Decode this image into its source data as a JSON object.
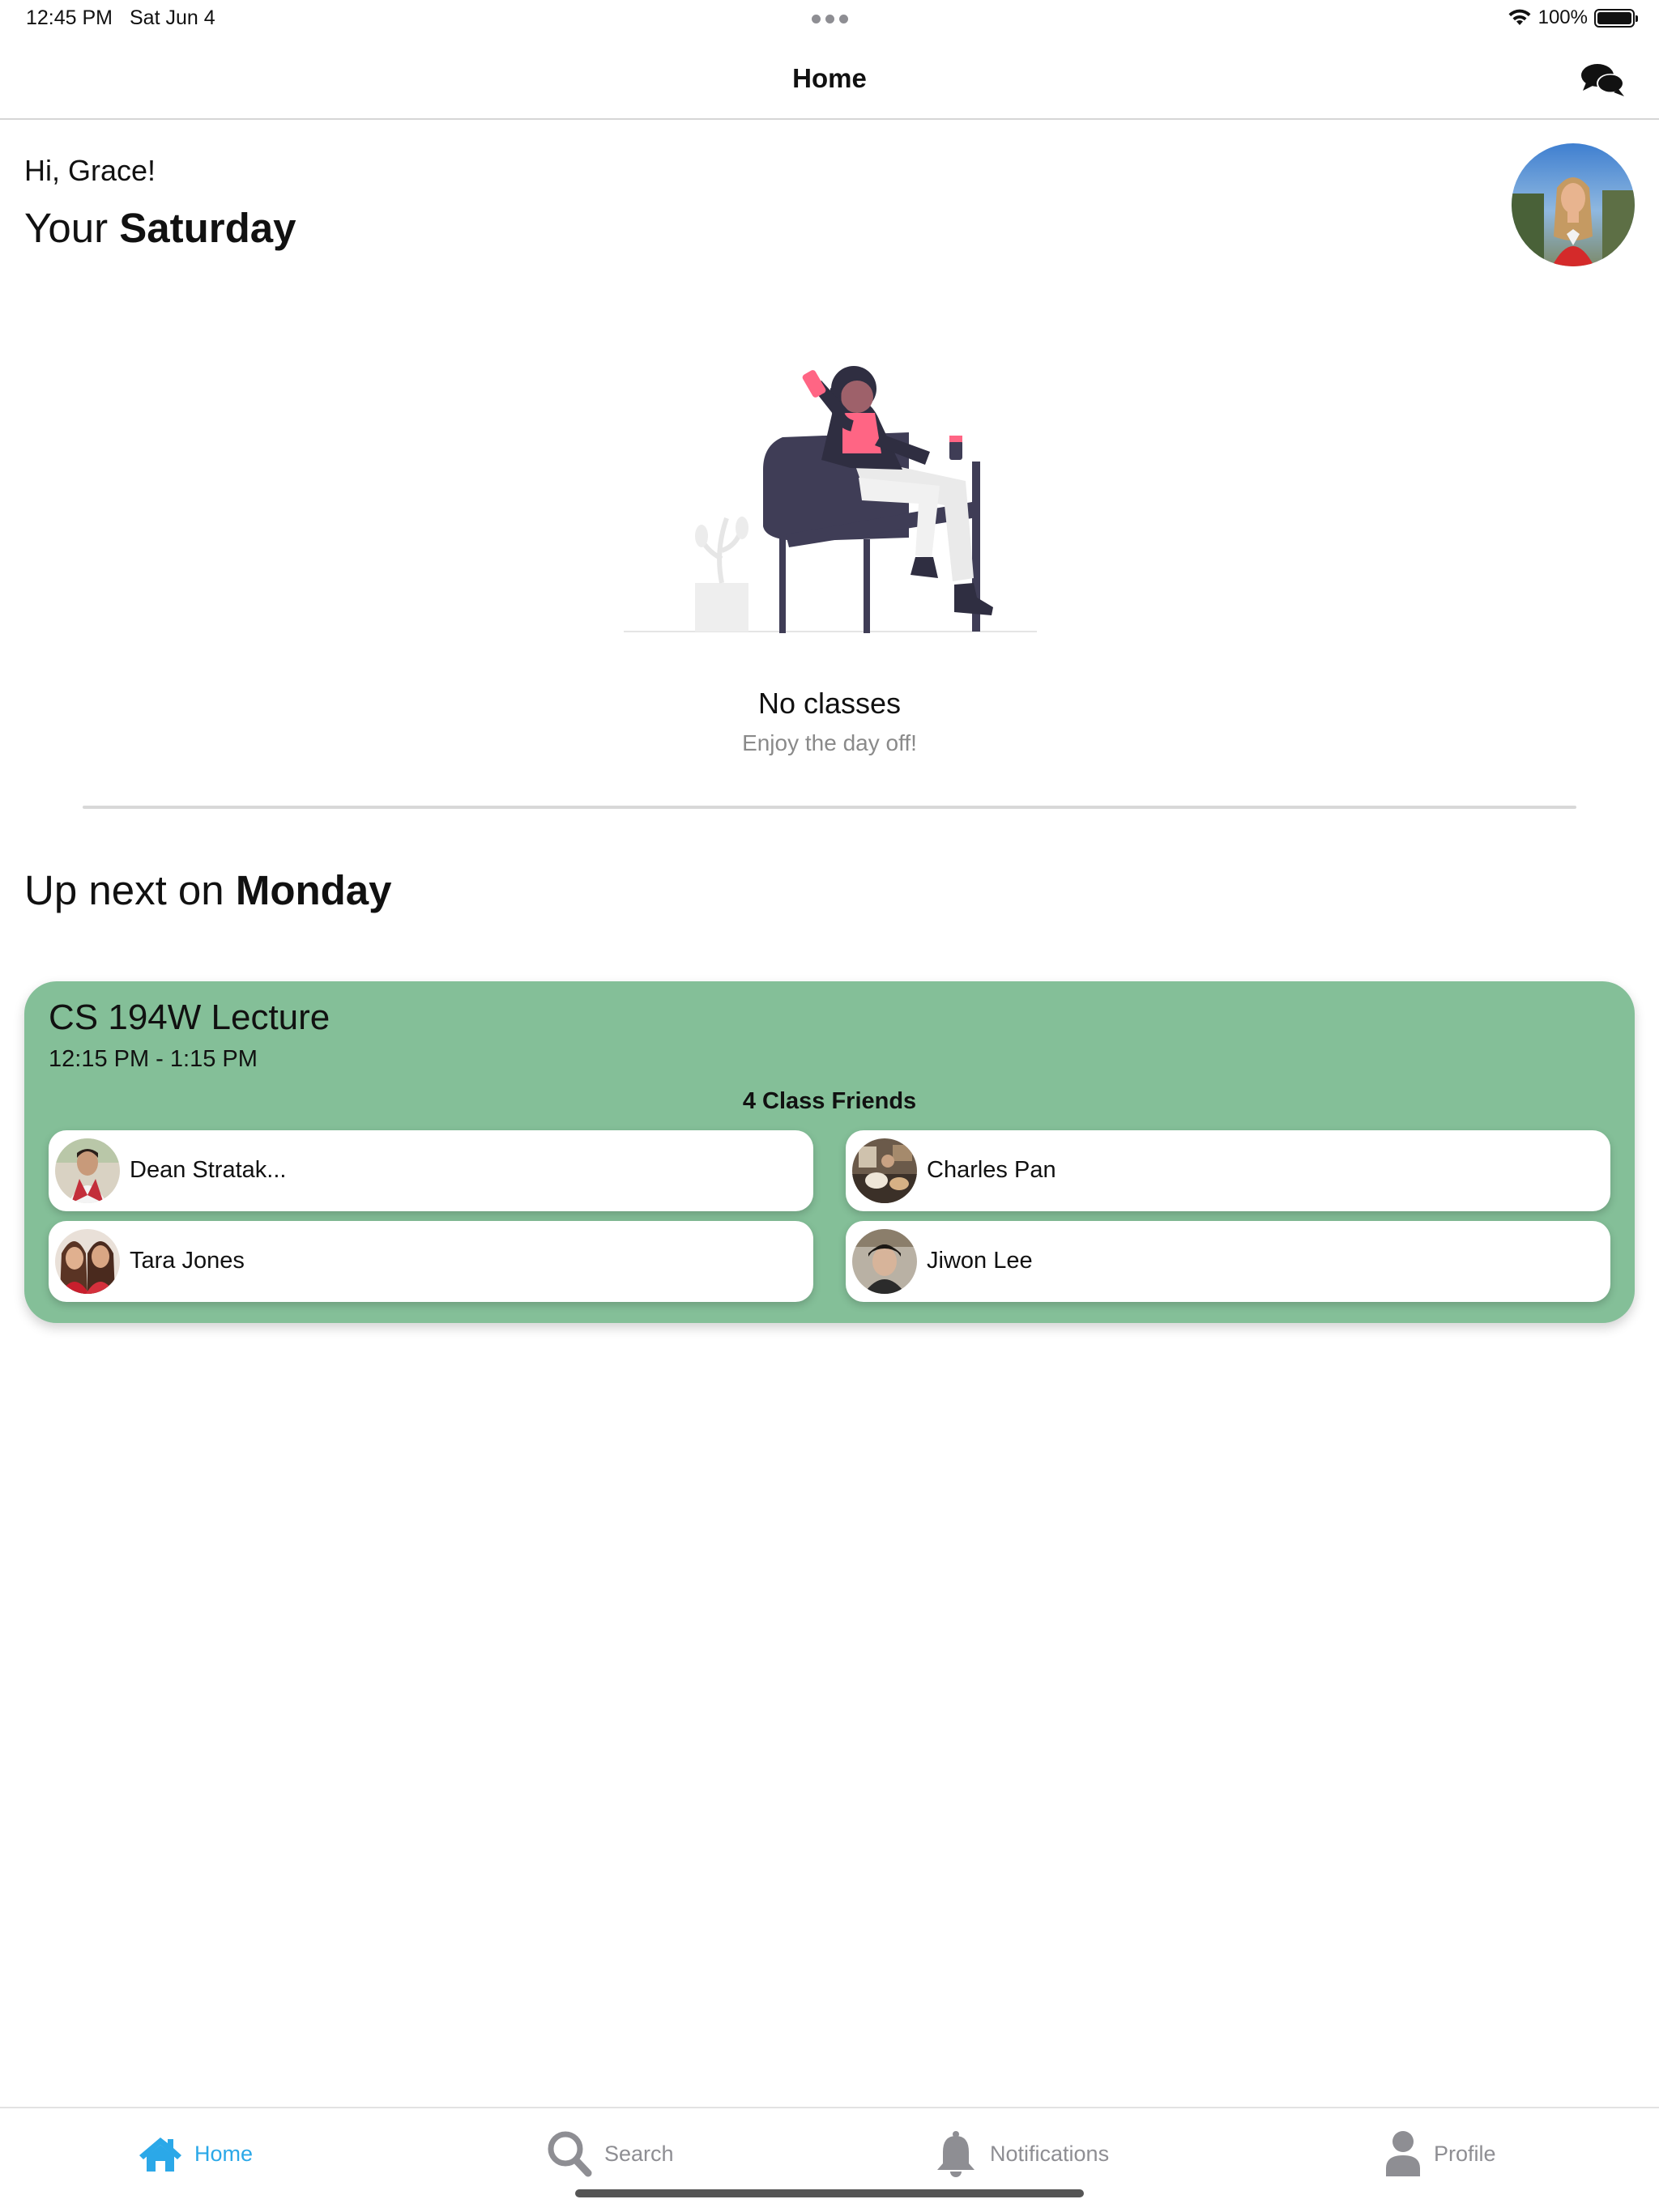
{
  "status_bar": {
    "time": "12:45 PM",
    "date": "Sat Jun 4",
    "battery": "100%",
    "battery_level": 1.0
  },
  "nav": {
    "title": "Home",
    "right_icon": "chat-bubbles-icon"
  },
  "greeting": {
    "hello": "Hi, Grace!",
    "day_prefix": "Your",
    "day_name": "Saturday"
  },
  "empty_state": {
    "title": "No classes",
    "subtitle": "Enjoy the day off!"
  },
  "up_next": {
    "prefix": "Up next on",
    "day_name": "Monday"
  },
  "class_card": {
    "name": "CS 194W Lecture",
    "time": "12:15 PM - 1:15 PM",
    "friends_heading": "4 Class Friends",
    "background": "#84bf98",
    "friends": [
      {
        "name": "Dean Stratak..."
      },
      {
        "name": "Charles Pan"
      },
      {
        "name": "Tara Jones"
      },
      {
        "name": "Jiwon Lee"
      }
    ]
  },
  "tab_bar": {
    "accent": "#2ba8e8",
    "tabs": [
      {
        "label": "Home",
        "icon": "house-icon",
        "active": true
      },
      {
        "label": "Search",
        "icon": "magnifier-icon",
        "active": false
      },
      {
        "label": "Notifications",
        "icon": "bell-icon",
        "active": false
      },
      {
        "label": "Profile",
        "icon": "person-icon",
        "active": false
      }
    ]
  }
}
